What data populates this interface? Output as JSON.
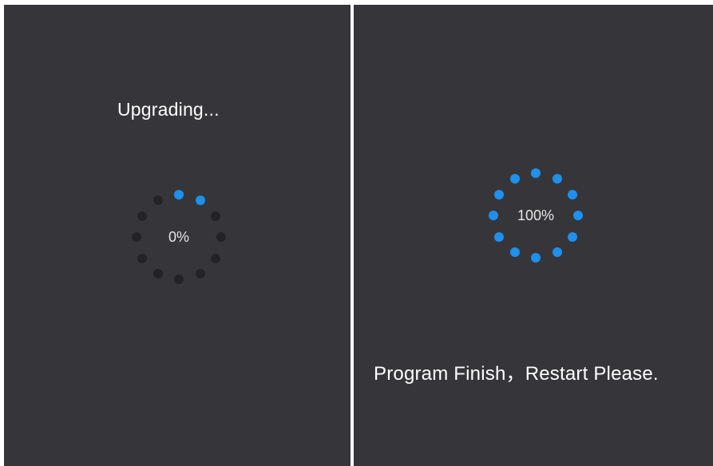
{
  "upgrade_screen": {
    "message": "Upgrading...",
    "progress_label": "0%",
    "progress_fraction": 0.0,
    "spinner_active_dots": 2,
    "spinner_total_dots": 12
  },
  "finish_screen": {
    "progress_label": "100%",
    "progress_fraction": 1.0,
    "spinner_active_dots": 12,
    "spinner_total_dots": 12,
    "message": "Program Finish，Restart Please."
  },
  "colors": {
    "panel_background": "#36363a",
    "dot_active": "#1e90ee",
    "dot_inactive": "#232325",
    "text": "#ffffff"
  }
}
